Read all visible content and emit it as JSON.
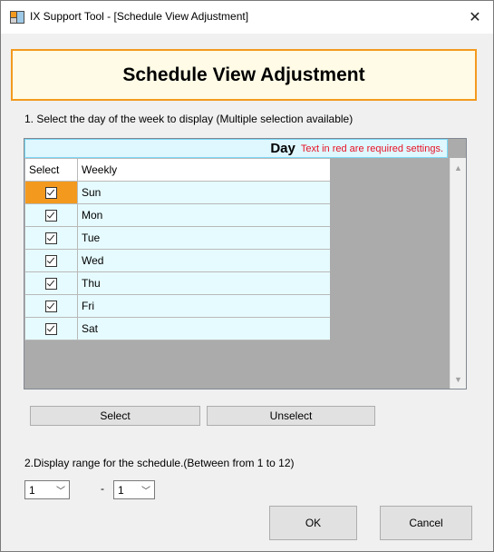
{
  "window": {
    "title": "IX Support Tool - [Schedule View Adjustment]",
    "close_glyph": "✕"
  },
  "header": {
    "title": "Schedule View Adjustment"
  },
  "section1": {
    "label": "1. Select the day of the week to display (Multiple selection available)"
  },
  "grid": {
    "title": "Day",
    "required_note": "Text in red are required settings.",
    "columns": [
      "Select",
      "Weekly"
    ],
    "rows": [
      {
        "day": "Sun",
        "checked": true,
        "active": true
      },
      {
        "day": "Mon",
        "checked": true,
        "active": false
      },
      {
        "day": "Tue",
        "checked": true,
        "active": false
      },
      {
        "day": "Wed",
        "checked": true,
        "active": false
      },
      {
        "day": "Thu",
        "checked": true,
        "active": false
      },
      {
        "day": "Fri",
        "checked": true,
        "active": false
      },
      {
        "day": "Sat",
        "checked": true,
        "active": false
      }
    ]
  },
  "buttons": {
    "select": "Select",
    "unselect": "Unselect",
    "ok": "OK",
    "cancel": "Cancel"
  },
  "section2": {
    "label": "2.Display range for the schedule.(Between from 1 to 12)"
  },
  "range": {
    "from_value": "1",
    "separator": "-",
    "to_value": "1"
  },
  "colors": {
    "accent_orange": "#f39a1e",
    "grid_cyan": "#e6fbff",
    "required_red": "#e81123"
  }
}
